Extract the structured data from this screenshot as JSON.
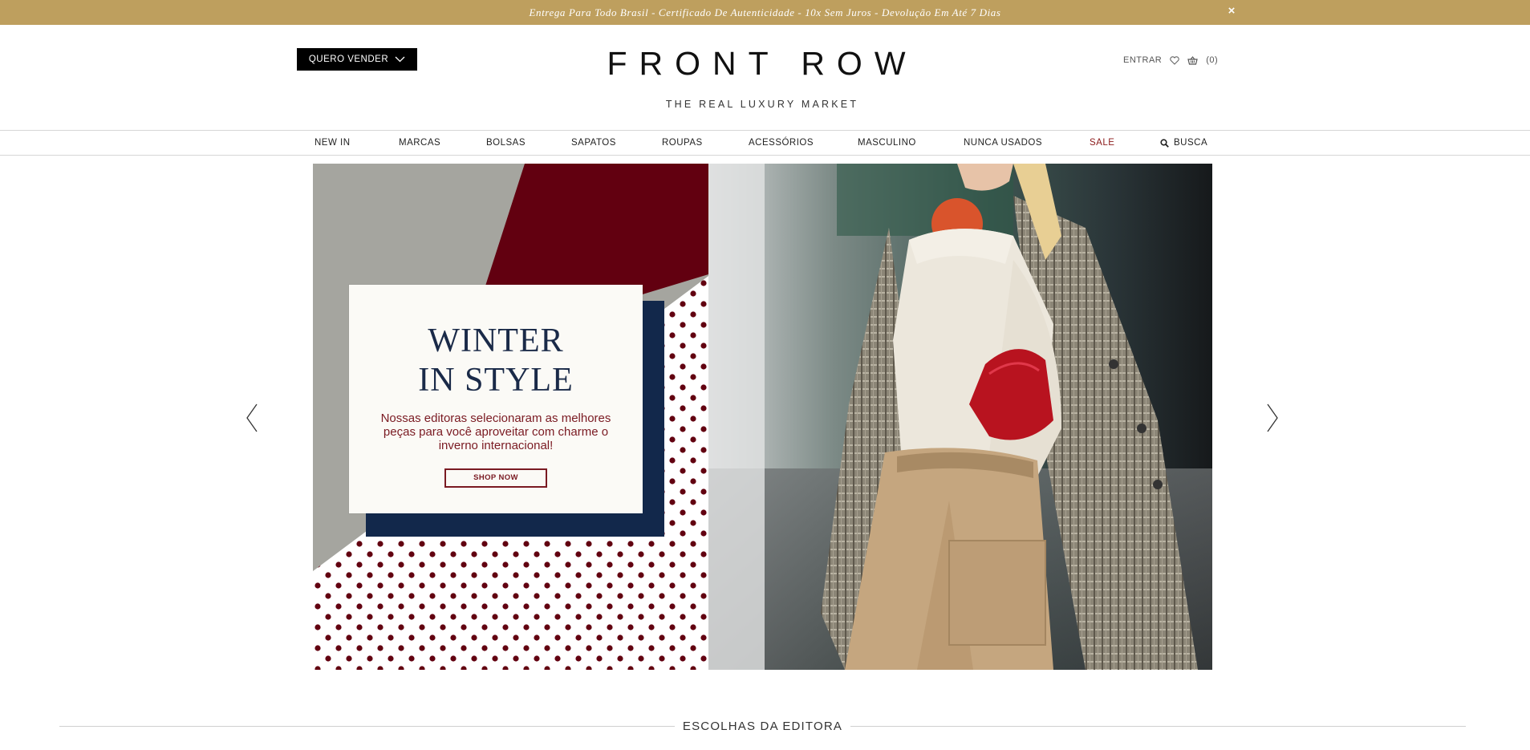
{
  "promo": {
    "text": "Entrega Para Todo Brasil - Certificado De Autenticidade - 10x Sem Juros - Devolução Em Até 7 Dias",
    "close_label": "×",
    "background": "#be9f5e"
  },
  "header": {
    "sell_button_label": "QUERO VENDER",
    "logo": "FRONT ROW",
    "tagline": "THE REAL LUXURY MARKET",
    "login_label": "ENTRAR",
    "cart_count": "(0)",
    "icons": [
      "chevron-down-icon",
      "heart-icon",
      "basket-icon",
      "search-icon"
    ]
  },
  "nav": {
    "items": [
      {
        "label": "NEW IN"
      },
      {
        "label": "MARCAS"
      },
      {
        "label": "BOLSAS"
      },
      {
        "label": "SAPATOS"
      },
      {
        "label": "ROUPAS"
      },
      {
        "label": "ACESSÓRIOS"
      },
      {
        "label": "MASCULINO"
      },
      {
        "label": "NUNCA USADOS"
      },
      {
        "label": "SALE"
      },
      {
        "label": "BUSCA"
      }
    ],
    "sale_color": "#8b1a1a"
  },
  "banner": {
    "title_line1": "WINTER",
    "title_line2": "IN STYLE",
    "copy": "Nossas editoras selecionaram as melhores peças para você aproveitar com charme o inverno internacional!",
    "cta_label": "SHOP NOW",
    "colors": {
      "burgundy": "#620010",
      "navy": "#12284b",
      "grey": "#a5a59f",
      "card": "#fbfaf6"
    }
  },
  "section": {
    "title": "ESCOLHAS DA EDITORA"
  }
}
